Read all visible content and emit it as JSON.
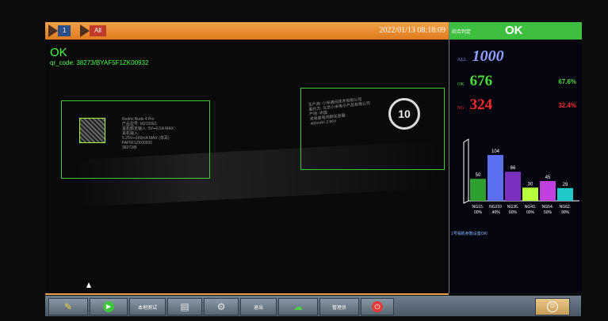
{
  "topbar": {
    "btn1_label": "1",
    "btn2_label": "All",
    "datetime": "2022/01/13 08:18:09"
  },
  "view": {
    "result": "OK",
    "qr_code": "qr_code: 38273/BYAF5F1ZK00932",
    "roi1_lines": "Redmi Buds 4 Pro\n产品型号: M2132E1\n耳机额定输入: 5V⎓0.5A MAX\n耳机输入:\n5.25V⎓160mA MAX (单耳)\nFAF5F1ZK00932\n38273/B",
    "roi1_serial": "38273/B",
    "roi2_lines": "生产商: 小米通讯技术有限公司\n委托方: 北京小米电子产品有限公司\n产地: 中国\n充电盒电池额定容量:\n480mAh 3.86V",
    "badge": "10"
  },
  "panel": {
    "verdict_small": "综合判定",
    "verdict": "OK",
    "all_tag": "ALL",
    "all_value": "1000",
    "ok_tag": "OK",
    "ok_value": "676",
    "ok_pct": "67.6%",
    "ng_tag": "NG",
    "ng_value": "324",
    "ng_pct": "32.4%",
    "status": "1号相机参数设置OK!"
  },
  "chart_data": {
    "type": "bar",
    "categories": [
      "NG15.00%",
      "NG210.40%",
      "NG36.60%",
      "NG43.00%",
      "NG54.50%",
      "NG62.90%"
    ],
    "values": [
      50,
      104,
      66,
      30,
      45,
      29
    ],
    "colors": [
      "#2ea02e",
      "#5a70f0",
      "#7b2fbf",
      "#b6ff3a",
      "#c040e0",
      "#20c8c8"
    ],
    "ylim": [
      0,
      140
    ]
  },
  "taskbar": {
    "b3_label": "本地测试",
    "b6_label": "退出",
    "b8_label": "管理员"
  },
  "colors": {
    "accent": "#e8891f",
    "ok_green": "#3fbf3f",
    "ng_red": "#ff2a2a",
    "roi_green": "#3dc83d"
  }
}
